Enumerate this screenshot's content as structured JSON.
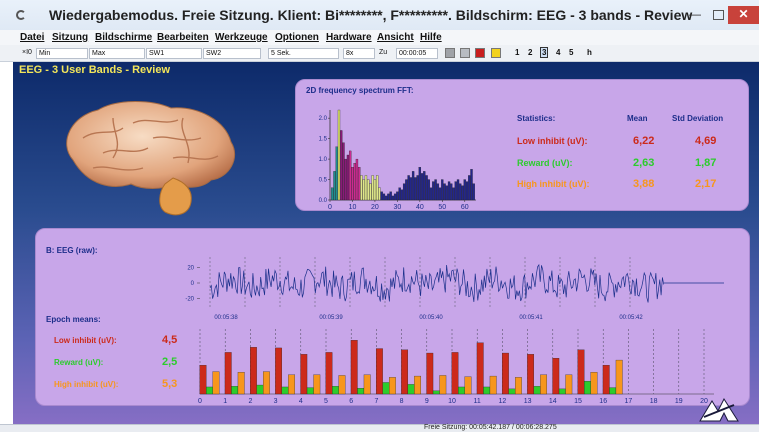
{
  "window": {
    "title": "Wiedergabemodus. Freie Sitzung. Klient: Bi********, F*********. Bildschirm: EEG - 3 bands - Review",
    "min_glyph": "—",
    "close_glyph": "✕"
  },
  "menu": [
    "Datei",
    "Sitzung",
    "Bildschirme",
    "Bearbeiten",
    "Werkzeuge",
    "Optionen",
    "Hardware",
    "Ansicht",
    "Hilfe"
  ],
  "toolbar": {
    "zoom": "×I0",
    "min": "Min",
    "max": "Max",
    "sw1": "SW1",
    "sw2": "SW2",
    "period": "5 Sek.",
    "speed": "8x",
    "zu_label": "Zu",
    "time": "00:00:05",
    "pages": [
      "1",
      "2",
      "3",
      "4",
      "5"
    ],
    "selected_page": "3",
    "end": "h"
  },
  "screen": {
    "title": "EEG - 3 User Bands - Review"
  },
  "fft": {
    "title": "2D frequency spectrum FFT:"
  },
  "statistics": {
    "header": "Statistics:",
    "mean_header": "Mean",
    "std_header": "Std Deviation",
    "rows": [
      {
        "label": "Low inhibit (uV):",
        "mean": "6,22",
        "std": "4,69",
        "color": "#cc2a1a"
      },
      {
        "label": "Reward (uV):",
        "mean": "2,63",
        "std": "1,87",
        "color": "#2ccc2c"
      },
      {
        "label": "High inhibit (uV):",
        "mean": "3,88",
        "std": "2,17",
        "color": "#f7961c"
      }
    ]
  },
  "eeg": {
    "title": "B: EEG (raw):"
  },
  "epoch": {
    "title": "Epoch means:",
    "rows": [
      {
        "label": "Low inhibit (uV):",
        "value": "4,5",
        "color": "#cc2a1a"
      },
      {
        "label": "Reward (uV):",
        "value": "2,5",
        "color": "#2ccc2c"
      },
      {
        "label": "High inhibit (uV):",
        "value": "5,3",
        "color": "#f7961c"
      }
    ]
  },
  "status": {
    "text": "Freie Sitzung: 00:05:42.187 / 00:06:28.275"
  },
  "colors": {
    "background_top": "#0d2a6a",
    "panel": "#c8a6e9",
    "title_yellow": "#f3e65a",
    "label_blue": "#1d2e8a",
    "trace": "#1a2f8a"
  },
  "chart_data": [
    {
      "type": "bar",
      "name_key": "fft",
      "xlim": [
        0,
        65
      ],
      "ylim": [
        0,
        2.2
      ],
      "x_ticks": [
        "0",
        "10",
        "20",
        "30",
        "40",
        "50",
        "60"
      ],
      "y_ticks": [
        "0.0",
        "0.5",
        "1.0",
        "1.5",
        "2.0"
      ],
      "x": [
        1,
        2,
        3,
        4,
        5,
        6,
        7,
        8,
        9,
        10,
        11,
        12,
        13,
        14,
        15,
        16,
        17,
        18,
        19,
        20,
        21,
        22,
        23,
        24,
        25,
        26,
        27,
        28,
        29,
        30,
        31,
        32,
        33,
        34,
        35,
        36,
        37,
        38,
        39,
        40,
        41,
        42,
        43,
        44,
        45,
        46,
        47,
        48,
        49,
        50,
        51,
        52,
        53,
        54,
        55,
        56,
        57,
        58,
        59,
        60,
        61,
        62,
        63,
        64
      ],
      "values": [
        0.3,
        0.7,
        1.3,
        2.2,
        1.7,
        1.4,
        1.0,
        1.1,
        1.2,
        0.8,
        0.9,
        1.0,
        0.8,
        0.6,
        0.5,
        0.6,
        0.5,
        0.4,
        0.6,
        0.5,
        0.6,
        0.3,
        0.2,
        0.15,
        0.1,
        0.15,
        0.2,
        0.1,
        0.15,
        0.2,
        0.3,
        0.25,
        0.4,
        0.5,
        0.6,
        0.55,
        0.7,
        0.55,
        0.6,
        0.8,
        0.65,
        0.7,
        0.6,
        0.5,
        0.3,
        0.45,
        0.5,
        0.4,
        0.3,
        0.5,
        0.4,
        0.35,
        0.45,
        0.4,
        0.3,
        0.45,
        0.5,
        0.4,
        0.35,
        0.5,
        0.45,
        0.6,
        0.75,
        0.4
      ],
      "bands": [
        {
          "from": 1,
          "to": 3,
          "color": "#1f8f8f"
        },
        {
          "from": 4,
          "to": 4,
          "color": "#d8e068"
        },
        {
          "from": 5,
          "to": 8,
          "color": "#8a1a78"
        },
        {
          "from": 9,
          "to": 13,
          "color": "#cc2a90"
        },
        {
          "from": 14,
          "to": 22,
          "color": "#e0e88a"
        },
        {
          "from": 23,
          "to": 64,
          "color": "#23268a"
        }
      ]
    },
    {
      "type": "line",
      "name_key": "eeg_raw",
      "x_ticks": [
        "00:05:38",
        "00:05:39",
        "00:05:40",
        "00:05:41",
        "00:05:42"
      ],
      "y_ticks": [
        "20",
        "0",
        "-20"
      ],
      "ylim": [
        -28,
        28
      ]
    },
    {
      "type": "bar",
      "name_key": "epoch_means",
      "categories": [
        "1",
        "2",
        "3",
        "4",
        "5",
        "6",
        "7",
        "8",
        "9",
        "10",
        "11",
        "12",
        "13",
        "14",
        "15",
        "16",
        "17"
      ],
      "x_ticks": [
        "0",
        "1",
        "2",
        "3",
        "4",
        "5",
        "6",
        "7",
        "8",
        "9",
        "10",
        "11",
        "12",
        "13",
        "14",
        "15",
        "16",
        "17",
        "18",
        "19",
        "20"
      ],
      "ylim": [
        0,
        10
      ],
      "series": [
        {
          "name": "Low inhibit (uV):",
          "color": "#cc2a1a",
          "values": [
            4.5,
            6.5,
            7.3,
            7.2,
            6.2,
            6.5,
            8.4,
            7.1,
            6.9,
            6.4,
            6.5,
            8.0,
            6.4,
            6.2,
            5.6,
            6.9,
            4.5
          ]
        },
        {
          "name": "Reward (uV):",
          "color": "#2ccc2c",
          "values": [
            1.1,
            1.2,
            1.4,
            1.1,
            1.0,
            1.2,
            0.9,
            1.8,
            1.5,
            0.5,
            1.1,
            1.1,
            0.8,
            1.2,
            0.8,
            2.0,
            1.0
          ]
        },
        {
          "name": "High inhibit (uV):",
          "color": "#f7961c",
          "values": [
            3.5,
            3.4,
            3.5,
            3.0,
            3.0,
            2.9,
            3.0,
            2.6,
            2.8,
            2.9,
            2.7,
            2.8,
            2.6,
            3.0,
            3.0,
            3.4,
            5.3
          ]
        }
      ]
    }
  ]
}
